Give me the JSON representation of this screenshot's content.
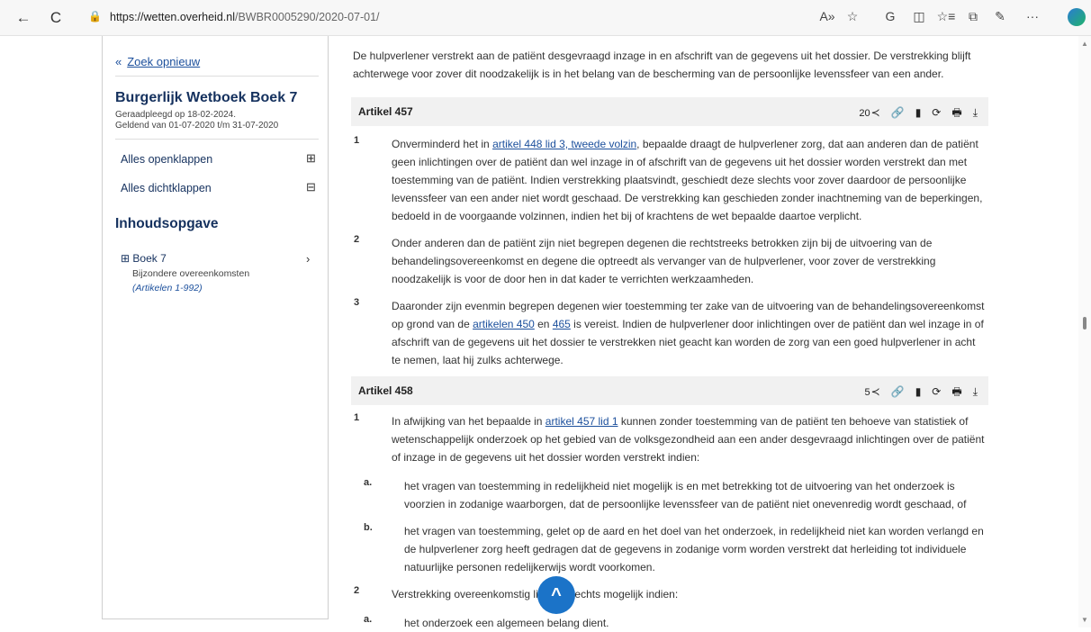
{
  "browser": {
    "back": "←",
    "reload": "C",
    "lock": "🔒",
    "url_host": "https://wetten.overheid.nl",
    "url_path": "/BWBR0005290/2020-07-01/",
    "icons": [
      "A»",
      "☆",
      "G",
      "◫",
      "☆≡",
      "⧉",
      "✎",
      "···"
    ]
  },
  "sidebar": {
    "back_icon": "«",
    "back_label": "Zoek opnieuw",
    "title": "Burgerlijk Wetboek Boek 7",
    "consulted": "Geraadpleegd op 18-02-2024.",
    "valid": "Geldend van 01-07-2020 t/m 31-07-2020",
    "expand_all": "Alles openklappen",
    "expand_icon": "⊞",
    "collapse_all": "Alles dichtklappen",
    "collapse_icon": "⊟",
    "toc_title": "Inhoudsopgave",
    "toc_item": "⊞ Boek 7",
    "toc_sub": "Bijzondere overeenkomsten",
    "toc_range": "(Artikelen 1-992)",
    "toc_chevron": "›"
  },
  "content": {
    "intro": "De hulpverlener verstrekt aan de patiënt desgevraagd inzage in en afschrift van de gegevens uit het dossier. De verstrekking blijft achterwege voor zover dit noodzakelijk is in het belang van de bescherming van de persoonlijke levenssfeer van een ander.",
    "art457": {
      "title": "Artikel 457",
      "count": "20",
      "items": [
        {
          "num": "1",
          "pre": "Onverminderd het in ",
          "link": "artikel 448 lid 3, tweede volzin",
          "post": ", bepaalde draagt de hulpverlener zorg, dat aan anderen dan de patiënt geen inlichtingen over de patiënt dan wel inzage in of afschrift van de gegevens uit het dossier worden verstrekt dan met toestemming van de patiënt. Indien verstrekking plaatsvindt, geschiedt deze slechts voor zover daardoor de persoonlijke levenssfeer van een ander niet wordt geschaad. De verstrekking kan geschieden zonder inachtneming van de beperkingen, bedoeld in de voorgaande volzinnen, indien het bij of krachtens de wet bepaalde daartoe verplicht."
        },
        {
          "num": "2",
          "text": "Onder anderen dan de patiënt zijn niet begrepen degenen die rechtstreeks betrokken zijn bij de uitvoering van de behandelingsovereenkomst en degene die optreedt als vervanger van de hulpverlener, voor zover de verstrekking noodzakelijk is voor de door hen in dat kader te verrichten werkzaamheden."
        },
        {
          "num": "3",
          "pre": "Daaronder zijn evenmin begrepen degenen wier toestemming ter zake van de uitvoering van de behandelingsovereenkomst op grond van de ",
          "link1": "artikelen 450",
          "mid": " en ",
          "link2": "465",
          "post": " is vereist. Indien de hulpverlener door inlichtingen over de patiënt dan wel inzage in of afschrift van de gegevens uit het dossier te verstrekken niet geacht kan worden de zorg van een goed hulpverlener in acht te nemen, laat hij zulks achterwege."
        }
      ]
    },
    "art458": {
      "title": "Artikel 458",
      "count": "5",
      "item1": {
        "num": "1",
        "pre": "In afwijking van het bepaalde in ",
        "link": "artikel 457 lid 1",
        "post": " kunnen zonder toestemming van de patiënt ten behoeve van statistiek of wetenschappelijk onderzoek op het gebied van de volksgezondheid aan een ander desgevraagd inlichtingen over de patiënt of inzage in de gegevens uit het dossier worden verstrekt indien:"
      },
      "sub_a": {
        "num": "a.",
        "text": "het vragen van toestemming in redelijkheid niet mogelijk is en met betrekking tot de uitvoering van het onderzoek is voorzien in zodanige waarborgen, dat de persoonlijke levenssfeer van de patiënt niet onevenredig wordt geschaad, of"
      },
      "sub_b": {
        "num": "b.",
        "text": "het vragen van toestemming, gelet op de aard en het doel van het onderzoek, in redelijkheid niet kan worden verlangd en de hulpverlener zorg heeft gedragen dat de gegevens in zodanige vorm worden verstrekt dat herleiding tot individuele natuurlijke personen redelijkerwijs wordt voorkomen."
      },
      "item2": {
        "num": "2",
        "text": "Verstrekking overeenkomstig lid 1 is slechts mogelijk indien:"
      },
      "sub_a2": {
        "num": "a.",
        "text": "het onderzoek een algemeen belang dient."
      }
    },
    "tools": [
      "≺",
      "🔗",
      "▮",
      "⟳",
      "🖶",
      "⤓"
    ]
  },
  "scroll": {
    "up": "▲",
    "down": "▼",
    "to_top": "^"
  }
}
